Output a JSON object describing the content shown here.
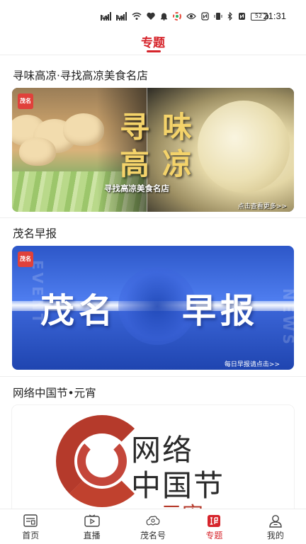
{
  "status_bar": {
    "time": "21:31",
    "battery": "52",
    "sim1_label": "5G",
    "sim2_label": "4G"
  },
  "header": {
    "title": "专题"
  },
  "topics": [
    {
      "title": "寻味高凉·寻找高凉美食名店",
      "banner_badge": "茂名",
      "banner_calligraphy": [
        "寻",
        "味",
        "高",
        "凉"
      ],
      "banner_subtitle": "寻找高凉美食名店",
      "banner_more": "点击查看更多>>"
    },
    {
      "title": "茂名早报",
      "banner_badge": "茂名",
      "banner_word_left": "茂名",
      "banner_word_right": "早报",
      "banner_ghost_left": "EVENT",
      "banner_ghost_right": "NEWS",
      "banner_more": "每日早报请点击>>"
    },
    {
      "title": "网络中国节•元宵",
      "banner_line1": "网络",
      "banner_line2": "中国节",
      "banner_line3": "元宵"
    }
  ],
  "bottom_nav": [
    {
      "label": "首页",
      "icon": "home-news-icon",
      "active": false
    },
    {
      "label": "直播",
      "icon": "tv-play-icon",
      "active": false
    },
    {
      "label": "茂名号",
      "icon": "cloud-pattern-icon",
      "active": false
    },
    {
      "label": "专题",
      "icon": "topic-icon",
      "active": true
    },
    {
      "label": "我的",
      "icon": "user-icon",
      "active": false
    }
  ],
  "colors": {
    "accent": "#d6242b",
    "text": "#222222",
    "divider": "#eeeeee"
  }
}
